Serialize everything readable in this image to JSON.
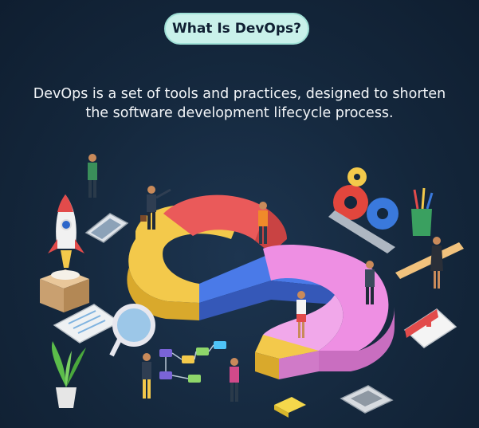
{
  "header": {
    "title": "What Is DevOps?"
  },
  "intro": {
    "line1": "DevOps is a set of tools and practices, designed to shorten",
    "line2": "the software development lifecycle process."
  },
  "colors": {
    "background": "#14273c",
    "pill": "#c9f1ea",
    "loop_yellow": "#f3c94b",
    "loop_red": "#ea5a5a",
    "loop_blue": "#4a7ae8",
    "loop_pink": "#ee8fe3"
  },
  "illustration": {
    "icons": [
      "rocket-icon",
      "phone-icon",
      "box-icon",
      "clipboard-icon",
      "magnifier-icon",
      "plant-icon",
      "flowchart-icon",
      "gears-icon",
      "pencil-cup-icon",
      "ruler-icon",
      "calendar-icon",
      "calculator-icon",
      "sticky-notes-icon",
      "infinity-loop-icon"
    ]
  }
}
